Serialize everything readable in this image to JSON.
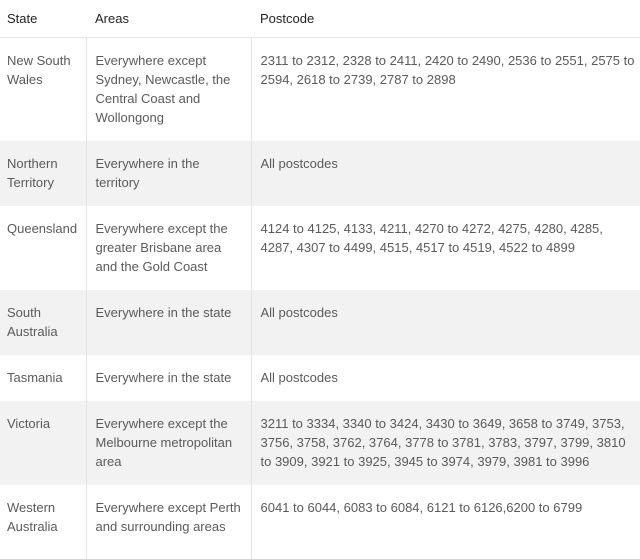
{
  "table": {
    "headers": [
      "State",
      "Areas",
      "Postcode"
    ],
    "rows": [
      {
        "state": "New South Wales",
        "areas": "Everywhere except Sydney, Newcastle, the Central Coast and Wollongong",
        "postcode": "2311 to 2312, 2328 to 2411, 2420 to 2490, 2536 to 2551, 2575 to 2594, 2618 to 2739, 2787 to 2898"
      },
      {
        "state": "Northern Territory",
        "areas": "Everywhere in the territory",
        "postcode": "All postcodes"
      },
      {
        "state": "Queensland",
        "areas": "Everywhere except the greater Brisbane area and the Gold Coast",
        "postcode": "4124 to 4125, 4133, 4211, 4270 to 4272, 4275, 4280, 4285, 4287, 4307 to 4499, 4515, 4517 to 4519, 4522 to 4899"
      },
      {
        "state": "South Australia",
        "areas": "Everywhere in the state",
        "postcode": "All postcodes"
      },
      {
        "state": "Tasmania",
        "areas": "Everywhere in the state",
        "postcode": "All postcodes"
      },
      {
        "state": "Victoria",
        "areas": "Everywhere except the Melbourne metropolitan area",
        "postcode": "3211 to 3334, 3340 to 3424, 3430 to 3649, 3658 to 3749, 3753, 3756, 3758, 3762, 3764, 3778 to 3781, 3783, 3797, 3799, 3810 to 3909, 3921 to 3925, 3945 to 3974, 3979, 3981 to 3996"
      },
      {
        "state": "Western Australia",
        "areas": "Everywhere except Perth and surrounding areas",
        "postcode": "6041 to 6044, 6083 to 6084, 6121 to 6126,6200 to 6799"
      }
    ]
  }
}
